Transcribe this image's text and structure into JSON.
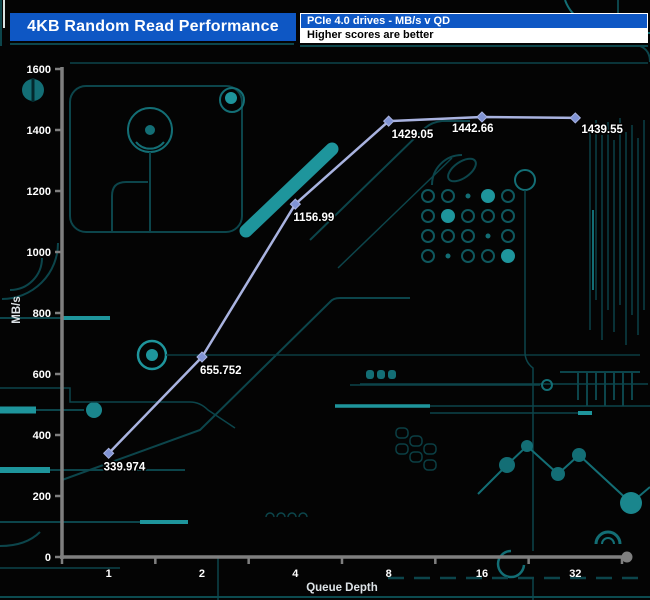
{
  "header": {
    "title": "4KB Random Read Performance",
    "subtitle_primary": "PCIe 4.0 drives - MB/s v QD",
    "subtitle_secondary": "Higher scores are better"
  },
  "chart_data": {
    "type": "line",
    "title": "4KB Random Read Performance",
    "subtitle": "PCIe 4.0 drives - MB/s v QD",
    "note": "Higher scores are better",
    "categories": [
      "1",
      "2",
      "4",
      "8",
      "16",
      "32"
    ],
    "values": [
      339.974,
      655.752,
      1156.99,
      1429.05,
      1442.66,
      1439.55
    ],
    "point_labels": [
      "339.974",
      "655.752",
      "1156.99",
      "1429.05",
      "1442.66",
      "1439.55"
    ],
    "xlabel": "Queue Depth",
    "ylabel": "MB/s",
    "ylim": [
      0,
      1600
    ],
    "ytick_interval": 200,
    "ytick_labels": [
      "0",
      "200",
      "400",
      "600",
      "800",
      "1000",
      "1200",
      "1400",
      "1600"
    ],
    "grid": false,
    "legend": "none",
    "line_color": "#a9b3e0",
    "marker_color": "#8093d4",
    "marker_shape": "diamond",
    "axis_color": "#7f7f7f",
    "label_color": "#ffffff"
  },
  "colors": {
    "background": "#040404",
    "title_bar_bg": "#0e57c4",
    "title_text": "#ffffff",
    "subtitle_bg": "#ffffff",
    "subtitle_text": "#000000",
    "circuit_dark": "#0c454b",
    "circuit_mid": "#136e75",
    "circuit_bright": "#1e959c"
  }
}
